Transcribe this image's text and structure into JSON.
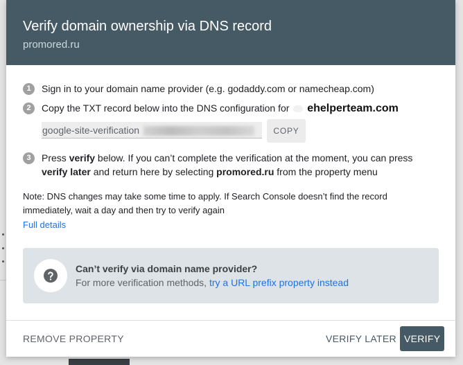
{
  "dialog": {
    "title": "Verify domain ownership via DNS record",
    "subtitle": "promored.ru"
  },
  "steps": [
    {
      "number": "1",
      "text": "Sign in to your domain name provider (e.g. godaddy.com or namecheap.com)"
    },
    {
      "number": "2",
      "text": "Copy the TXT record below into the DNS configuration for",
      "domain": "ehelperteam.com",
      "txt_record_prefix": "google-site-verification",
      "copy_label": "COPY"
    },
    {
      "number": "3",
      "line1_before": "Press ",
      "line1_bold": "verify",
      "line1_after": " below. If you can’t complete the verification at the moment, you can press",
      "line2_bold": "verify later",
      "line2_middle": " and return here by selecting ",
      "line2_bold2": "promored.ru",
      "line2_after": " from the property menu"
    }
  ],
  "note": {
    "line1": "Note: DNS changes may take some time to apply. If Search Console doesn’t find the record",
    "line2": "immediately, wait a day and then try to verify again",
    "link": "Full details"
  },
  "alternative": {
    "title": "Can’t verify via domain name provider?",
    "desc_prefix": "For more verification methods, ",
    "link": "try a URL prefix property instead"
  },
  "actions": {
    "remove": "REMOVE PROPERTY",
    "verify_later": "VERIFY LATER",
    "verify": "VERIFY"
  },
  "colors": {
    "header": "#455a64",
    "link": "#1a73e8",
    "alt_box": "#dde3e6"
  }
}
